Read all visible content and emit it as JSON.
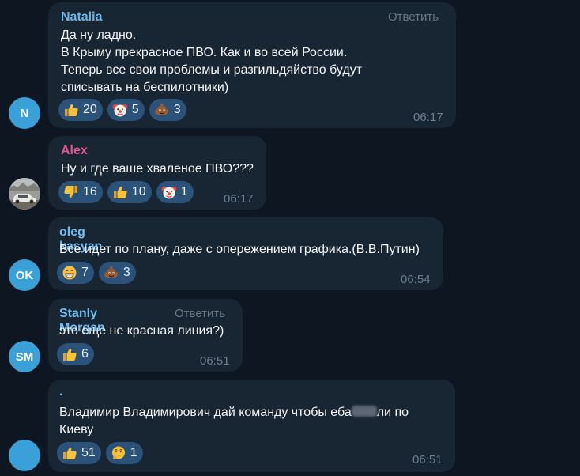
{
  "colors": {
    "background": "#0e1621",
    "bubble": "#182533",
    "reaction_pill": "#2b5278",
    "natalia": "#6cb6e8",
    "alex": "#e1578e",
    "oleg": "#72bdf0",
    "stanly": "#72bdf0",
    "avatar_blue": "#3aa0d8"
  },
  "messages": [
    {
      "sender": "Natalia",
      "avatar_initials": "N",
      "reply_label": "Ответить",
      "lines": [
        "Да ну ладно.",
        "В Крыму прекрасное ПВО. Как и во всей России.",
        "Теперь все свои проблемы и разгильдяйство будут",
        "списывать на беспилотники)"
      ],
      "reactions": [
        {
          "icon": "thumbs-up",
          "count": "20"
        },
        {
          "icon": "clown",
          "count": "5"
        },
        {
          "icon": "poop",
          "count": "3"
        }
      ],
      "time": "06:17"
    },
    {
      "sender": "Alex",
      "avatar_initials": "",
      "lines": [
        "Ну и где ваше хваленое ПВО???"
      ],
      "reactions": [
        {
          "icon": "thumbs-down",
          "count": "16"
        },
        {
          "icon": "thumbs-up",
          "count": "10"
        },
        {
          "icon": "clown",
          "count": "1"
        }
      ],
      "time": "06:17"
    },
    {
      "sender": "oleg kasyan",
      "avatar_initials": "OK",
      "lines": [
        "Все идет по плану, даже с опережением графика.(В.В.Путин)"
      ],
      "reactions": [
        {
          "icon": "grin",
          "count": "7"
        },
        {
          "icon": "poop",
          "count": "3"
        }
      ],
      "time": "06:54"
    },
    {
      "sender": "Stanly Morgan",
      "avatar_initials": "SM",
      "reply_label": "Ответить",
      "lines": [
        "это еще не красная линия?)"
      ],
      "reactions": [
        {
          "icon": "thumbs-up",
          "count": "6"
        }
      ],
      "time": "06:51"
    },
    {
      "sender": ".",
      "avatar_initials": "",
      "lines": [
        "Владимир Владимирович дай команду чтобы еба",
        "ли по",
        "Киеву"
      ],
      "reactions": [
        {
          "icon": "thumbs-up",
          "count": "51"
        },
        {
          "icon": "thinking",
          "count": "1"
        }
      ],
      "time": "06:51"
    }
  ]
}
